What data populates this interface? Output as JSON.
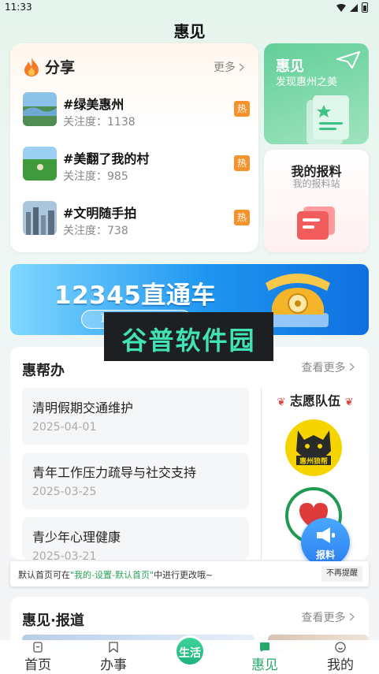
{
  "status": {
    "time": "11:33"
  },
  "app": {
    "title": "惠见"
  },
  "share": {
    "title": "分享",
    "more": "更多",
    "topics": [
      {
        "name": "#绿美惠州",
        "follow": "关注度：1138",
        "badge": "热"
      },
      {
        "name": "#美翻了我的村",
        "follow": "关注度：985",
        "badge": "热"
      },
      {
        "name": "#文明随手拍",
        "follow": "关注度：738",
        "badge": "热"
      }
    ]
  },
  "huijian_card": {
    "title": "惠见",
    "subtitle": "发现惠州之美"
  },
  "report_card": {
    "title": "我的报料",
    "subtitle": "我的报料站"
  },
  "banner": {
    "title": "12345直通车",
    "pill": "直接向部门提问"
  },
  "watermark": {
    "text": "谷普软件园"
  },
  "huibangban": {
    "title": "惠帮办",
    "more": "查看更多",
    "items": [
      {
        "title": "清明假期交通维护",
        "date": "2025-04-01"
      },
      {
        "title": "青年工作压力疏导与社交支持",
        "date": "2025-03-25"
      },
      {
        "title": "青少年心理健康",
        "date": "2025-03-21"
      }
    ],
    "volunteer_title": "志愿队伍",
    "volunteer_logo1_text": "惠州狼帮"
  },
  "toast": {
    "prefix": "默认首页可在",
    "highlight": "\"我的-设置-默认首页\"",
    "suffix": "中进行更改哦~",
    "button": "不再提醒"
  },
  "float_report": {
    "label": "报料"
  },
  "news": {
    "title": "惠见·报道",
    "more": "查看更多"
  },
  "nav": {
    "items": [
      {
        "label": "首页"
      },
      {
        "label": "办事"
      },
      {
        "label": "生活"
      },
      {
        "label": "惠见"
      },
      {
        "label": "我的"
      }
    ]
  },
  "colors": {
    "accent": "#25a86b",
    "hot": "#f5922b",
    "banner": "#1e96f0"
  }
}
